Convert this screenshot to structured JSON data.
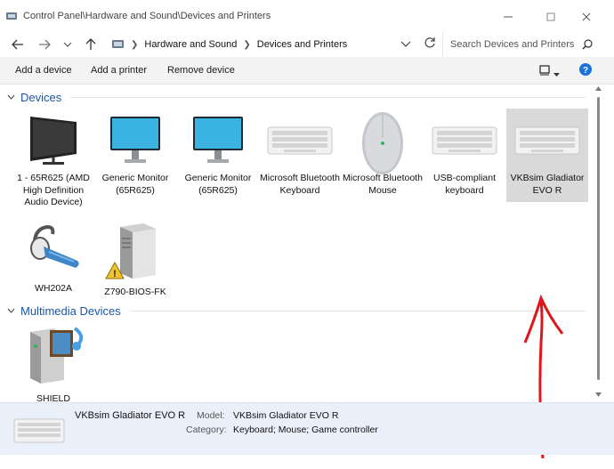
{
  "window": {
    "title": "Control Panel\\Hardware and Sound\\Devices and Printers"
  },
  "address": {
    "crumbs": [
      "Hardware and Sound",
      "Devices and Printers"
    ]
  },
  "search": {
    "placeholder": "Search Devices and Printers"
  },
  "commands": {
    "add_device": "Add a device",
    "add_printer": "Add a printer",
    "remove_device": "Remove device"
  },
  "groups": {
    "devices": "Devices",
    "multimedia": "Multimedia Devices"
  },
  "devices": [
    {
      "label": "1 - 65R625 (AMD High Definition Audio Device)",
      "icon": "tv-icon"
    },
    {
      "label": "Generic Monitor (65R625)",
      "icon": "monitor-icon"
    },
    {
      "label": "Generic Monitor (65R625)",
      "icon": "monitor-icon"
    },
    {
      "label": "Microsoft Bluetooth Keyboard",
      "icon": "keyboard-icon"
    },
    {
      "label": "Microsoft Bluetooth Mouse",
      "icon": "mouse-icon"
    },
    {
      "label": "USB-compliant keyboard",
      "icon": "keyboard-icon"
    },
    {
      "label": "VKBsim Gladiator EVO R",
      "icon": "keyboard-icon",
      "selected": true
    },
    {
      "label": "WH202A",
      "icon": "headset-icon"
    },
    {
      "label": "Z790-BIOS-FK",
      "icon": "computer-tower-icon",
      "warning": true
    }
  ],
  "multimedia": [
    {
      "label": "SHIELD",
      "icon": "media-device-icon"
    }
  ],
  "details": {
    "name": "VKBsim Gladiator EVO R",
    "model_label": "Model:",
    "model_value": "VKBsim Gladiator EVO R",
    "category_label": "Category:",
    "category_value": "Keyboard; Mouse; Game controller"
  },
  "colors": {
    "accent": "#1a56a7",
    "selection": "#d9d9d9",
    "annotation": "#e0151b",
    "details_bg": "#eaf0f9"
  }
}
